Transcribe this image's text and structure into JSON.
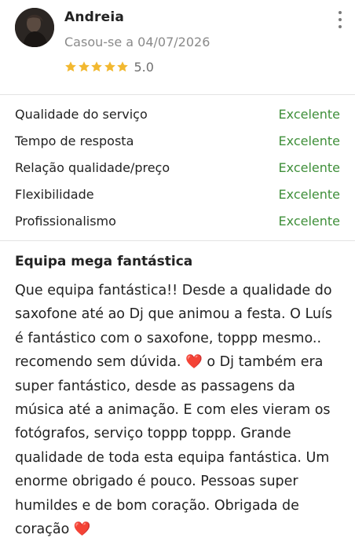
{
  "review": {
    "reviewer_name": "Andreia",
    "married_date": "Casou-se a 04/07/2026",
    "rating_value": "5.0",
    "stars_filled": 5,
    "star_color": "#f2b830",
    "criteria": [
      {
        "label": "Qualidade do serviço",
        "value": "Excelente"
      },
      {
        "label": "Tempo de resposta",
        "value": "Excelente"
      },
      {
        "label": "Relação qualidade/preço",
        "value": "Excelente"
      },
      {
        "label": "Flexibilidade",
        "value": "Excelente"
      },
      {
        "label": "Profissionalismo",
        "value": "Excelente"
      }
    ],
    "value_color": "#3f8f3a",
    "title": "Equipa mega fantástica",
    "body": "Que equipa fantástica!! Desde a qualidade do saxofone até ao Dj que animou a festa. O Luís é fantástico com o saxofone, toppp mesmo.. recomendo sem dúvida. ❤️ o Dj também era super fantástico, desde as passagens da música até a animação. E com eles vieram os fotógrafos, serviço toppp toppp. Grande qualidade de toda esta equipa fantástica. Um enorme obrigado é pouco. Pessoas super humildes e de bom coração. Obrigada de coração ❤️",
    "icons": {
      "avatar": "avatar",
      "star": "star-icon",
      "more": "more-options-icon"
    }
  }
}
